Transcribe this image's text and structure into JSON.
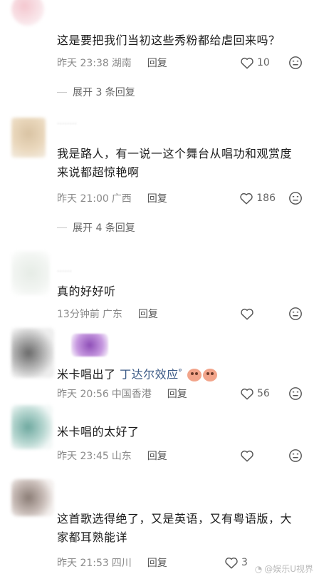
{
  "comments": [
    {
      "text": "这是要把我们当初这些秀粉都给虐回来吗？",
      "time": "昨天 23:38",
      "location": "湖南",
      "reply": "回复",
      "likes": "10",
      "expand": "展开 3 条回复"
    },
    {
      "text_line1": "我是路人，有一说一这个舞台从唱功和观赏度",
      "text_line2": "来说都超惊艳啊",
      "time": "昨天 21:00",
      "location": "广西",
      "reply": "回复",
      "likes": "186",
      "expand": "展开 4 条回复"
    },
    {
      "text": "真的好好听",
      "time": "13分钟前",
      "location": "广东",
      "reply": "回复",
      "likes": ""
    },
    {
      "text": "米卡唱出了 ",
      "link": "丁达尔效应",
      "time": "昨天 20:56",
      "location": "中国香港",
      "reply": "回复",
      "likes": "56"
    },
    {
      "text": "米卡唱的太好了",
      "time": "昨天 23:45",
      "location": "山东",
      "reply": "回复",
      "likes": ""
    },
    {
      "text_line1": "这首歌选得绝了，又是英语，又有粤语版，大",
      "text_line2": "家都耳熟能详",
      "time": "昨天 21:53",
      "location": "四川",
      "reply": "回复",
      "likes": "3"
    }
  ],
  "watermark": "@娱乐U视界",
  "icons": {
    "like": "heart-outline-icon",
    "dislike": "dislike-face-icon",
    "search": "search-icon",
    "emoji": "pig-emoji-icon"
  },
  "colors": {
    "text": "#1c1c1c",
    "meta": "#8a8a8a",
    "link": "#3b5a86",
    "divider": "#c8c8c8"
  }
}
